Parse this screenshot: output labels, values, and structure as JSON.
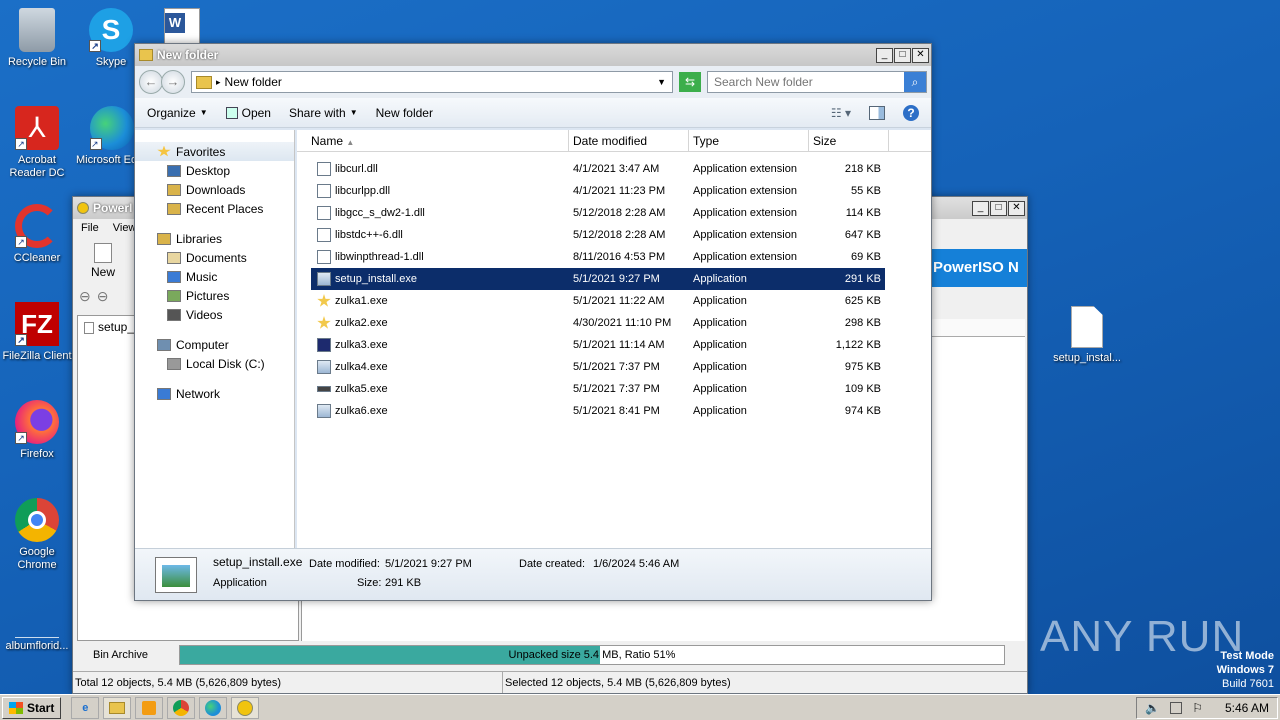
{
  "desktop": {
    "icons": [
      {
        "label": "Recycle Bin",
        "icon": "recycle-bin-icon"
      },
      {
        "label": "Skype",
        "icon": "skype-icon"
      },
      {
        "label": "Acrobat Reader DC",
        "icon": "acrobat-icon"
      },
      {
        "label": "Microsoft Ed",
        "icon": "edge-icon"
      },
      {
        "label": "CCleaner",
        "icon": "ccleaner-icon"
      },
      {
        "label": "FileZilla Client",
        "icon": "filezilla-icon"
      },
      {
        "label": "Firefox",
        "icon": "firefox-icon"
      },
      {
        "label": "Google Chrome",
        "icon": "chrome-icon"
      },
      {
        "label": "albumflorid...",
        "icon": "file-icon"
      },
      {
        "label": "setup_instal...",
        "icon": "blank-file-icon"
      }
    ],
    "watermark": "ANY RUN",
    "testmode": {
      "line1": "Test Mode",
      "line2": "Windows 7",
      "line3": "Build 7601"
    }
  },
  "poweriso": {
    "title": "PowerI",
    "menu": [
      "File",
      "View"
    ],
    "toolbar_new": "New",
    "file_item": "setup_",
    "banner": "PowerISO N",
    "status_type": "Bin Archive",
    "progress_text": "Unpacked size 5.4 MB, Ratio 51%",
    "progress_fraction": 0.51,
    "status_left": "Total 12 objects, 5.4 MB (5,626,809 bytes)",
    "status_right": "Selected 12 objects, 5.4 MB (5,626,809 bytes)"
  },
  "explorer": {
    "title": "New folder",
    "address": "New folder",
    "search_placeholder": "Search New folder",
    "commands": {
      "organize": "Organize",
      "open": "Open",
      "share": "Share with",
      "newfolder": "New folder"
    },
    "nav": [
      {
        "label": "Favorites",
        "indent": 0
      },
      {
        "label": "Desktop",
        "indent": 1
      },
      {
        "label": "Downloads",
        "indent": 1
      },
      {
        "label": "Recent Places",
        "indent": 1
      },
      {
        "label": "Libraries",
        "indent": 0
      },
      {
        "label": "Documents",
        "indent": 1
      },
      {
        "label": "Music",
        "indent": 1
      },
      {
        "label": "Pictures",
        "indent": 1
      },
      {
        "label": "Videos",
        "indent": 1
      },
      {
        "label": "Computer",
        "indent": 0
      },
      {
        "label": "Local Disk (C:)",
        "indent": 1
      },
      {
        "label": "Network",
        "indent": 0
      }
    ],
    "columns": {
      "name": "Name",
      "date": "Date modified",
      "type": "Type",
      "size": "Size"
    },
    "files": [
      {
        "name": "libcurl.dll",
        "date": "4/1/2021 3:47 AM",
        "type": "Application extension",
        "size": "218 KB"
      },
      {
        "name": "libcurlpp.dll",
        "date": "4/1/2021 11:23 PM",
        "type": "Application extension",
        "size": "55 KB"
      },
      {
        "name": "libgcc_s_dw2-1.dll",
        "date": "5/12/2018 2:28 AM",
        "type": "Application extension",
        "size": "114 KB"
      },
      {
        "name": "libstdc++-6.dll",
        "date": "5/12/2018 2:28 AM",
        "type": "Application extension",
        "size": "647 KB"
      },
      {
        "name": "libwinpthread-1.dll",
        "date": "8/11/2016 4:53 PM",
        "type": "Application extension",
        "size": "69 KB"
      },
      {
        "name": "setup_install.exe",
        "date": "5/1/2021 9:27 PM",
        "type": "Application",
        "size": "291 KB"
      },
      {
        "name": "zulka1.exe",
        "date": "5/1/2021 11:22 AM",
        "type": "Application",
        "size": "625 KB"
      },
      {
        "name": "zulka2.exe",
        "date": "4/30/2021 11:10 PM",
        "type": "Application",
        "size": "298 KB"
      },
      {
        "name": "zulka3.exe",
        "date": "5/1/2021 11:14 AM",
        "type": "Application",
        "size": "1,122 KB"
      },
      {
        "name": "zulka4.exe",
        "date": "5/1/2021 7:37 PM",
        "type": "Application",
        "size": "975 KB"
      },
      {
        "name": "zulka5.exe",
        "date": "5/1/2021 7:37 PM",
        "type": "Application",
        "size": "109 KB"
      },
      {
        "name": "zulka6.exe",
        "date": "5/1/2021 8:41 PM",
        "type": "Application",
        "size": "974 KB"
      }
    ],
    "selected_index": 5,
    "details": {
      "name": "setup_install.exe",
      "type": "Application",
      "modified_label": "Date modified:",
      "modified": "5/1/2021 9:27 PM",
      "created_label": "Date created:",
      "created": "1/6/2024 5:46 AM",
      "size_label": "Size:",
      "size": "291 KB"
    }
  },
  "taskbar": {
    "start": "Start",
    "clock": "5:46 AM"
  }
}
